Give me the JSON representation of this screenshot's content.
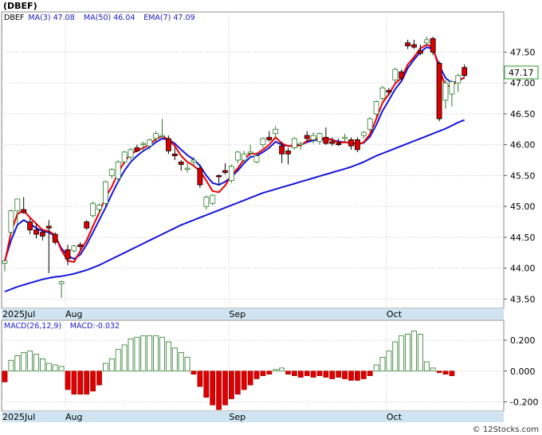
{
  "chart_data": [
    {
      "type": "candlestick",
      "title": "(DBEF)",
      "legend": [
        {
          "label": "DBEF",
          "color": "#000000"
        },
        {
          "label": "MA(3)",
          "value": "47.08",
          "color": "#1a1acc"
        },
        {
          "label": "MA(50)",
          "value": "46.04",
          "color": "#1a1acc"
        },
        {
          "label": "EMA(7)",
          "value": "47.09",
          "color": "#1a1acc"
        }
      ],
      "last_price_label": "47.17",
      "ylim": [
        43.35,
        48.15
      ],
      "yticks": [
        "43.50",
        "44.00",
        "44.50",
        "45.00",
        "45.50",
        "46.00",
        "46.50",
        "47.00",
        "47.50"
      ],
      "x_labels": [
        {
          "label": "2025Jul",
          "index": 0
        },
        {
          "label": "Aug",
          "index": 10
        },
        {
          "label": "Sep",
          "index": 36
        },
        {
          "label": "Oct",
          "index": 61
        }
      ],
      "colors": {
        "up": "#ffffff",
        "down": "#dd0000",
        "ma3": "#ee0000",
        "ma7": "#1515dd",
        "ma50": "#1515dd",
        "axis_band": "#cfe4f0"
      },
      "ohlc": [
        [
          44.08,
          44.12,
          43.95,
          44.12
        ],
        [
          44.58,
          44.95,
          44.55,
          44.93
        ],
        [
          44.93,
          45.08,
          44.7,
          45.12
        ],
        [
          44.95,
          45.15,
          44.88,
          44.9
        ],
        [
          44.75,
          44.8,
          44.55,
          44.62
        ],
        [
          44.62,
          44.72,
          44.48,
          44.55
        ],
        [
          44.58,
          44.63,
          44.45,
          44.52
        ],
        [
          44.68,
          44.78,
          43.92,
          44.65
        ],
        [
          44.55,
          44.58,
          44.38,
          44.42
        ],
        [
          43.75,
          43.8,
          43.52,
          43.78
        ],
        [
          44.3,
          44.38,
          44.05,
          44.15
        ],
        [
          44.28,
          44.38,
          44.25,
          44.36
        ],
        [
          44.38,
          44.42,
          44.3,
          44.35
        ],
        [
          44.75,
          44.78,
          44.62,
          44.65
        ],
        [
          44.85,
          45.08,
          44.82,
          45.05
        ],
        [
          44.95,
          45.05,
          44.88,
          45.02
        ],
        [
          45.05,
          45.42,
          45.0,
          45.4
        ],
        [
          45.5,
          45.62,
          45.45,
          45.6
        ],
        [
          45.45,
          45.75,
          45.4,
          45.72
        ],
        [
          45.72,
          45.9,
          45.68,
          45.88
        ],
        [
          45.8,
          45.95,
          45.75,
          45.92
        ],
        [
          45.95,
          46.0,
          45.88,
          45.9
        ],
        [
          46.0,
          46.05,
          45.88,
          46.02
        ],
        [
          45.98,
          46.1,
          45.92,
          46.08
        ],
        [
          46.1,
          46.22,
          46.05,
          46.18
        ],
        [
          46.15,
          46.42,
          46.12,
          46.15
        ],
        [
          46.1,
          46.15,
          45.85,
          45.9
        ],
        [
          45.85,
          45.95,
          45.75,
          45.82
        ],
        [
          45.72,
          45.75,
          45.58,
          45.68
        ],
        [
          45.62,
          45.7,
          45.55,
          45.62
        ],
        [
          45.72,
          45.8,
          45.65,
          45.75
        ],
        [
          45.62,
          45.68,
          45.3,
          45.35
        ],
        [
          45.0,
          45.18,
          44.95,
          45.15
        ],
        [
          45.05,
          45.2,
          45.02,
          45.18
        ],
        [
          45.5,
          45.52,
          45.35,
          45.48
        ],
        [
          45.58,
          45.7,
          45.52,
          45.55
        ],
        [
          45.42,
          45.68,
          45.38,
          45.65
        ],
        [
          45.75,
          45.9,
          45.7,
          45.88
        ],
        [
          45.75,
          45.9,
          45.72,
          45.85
        ],
        [
          45.88,
          46.0,
          45.82,
          45.88
        ],
        [
          45.72,
          45.85,
          45.7,
          45.82
        ],
        [
          46.0,
          46.12,
          45.95,
          46.1
        ],
        [
          46.12,
          46.22,
          46.05,
          46.08
        ],
        [
          46.18,
          46.3,
          46.12,
          46.25
        ],
        [
          45.98,
          46.05,
          45.7,
          45.85
        ],
        [
          45.9,
          45.95,
          45.68,
          45.85
        ],
        [
          45.95,
          46.12,
          45.92,
          46.1
        ],
        [
          46.0,
          46.05,
          45.92,
          46.02
        ],
        [
          46.15,
          46.22,
          46.05,
          46.1
        ],
        [
          46.08,
          46.2,
          46.02,
          46.15
        ],
        [
          46.05,
          46.2,
          46.0,
          46.18
        ],
        [
          46.12,
          46.28,
          46.0,
          46.02
        ],
        [
          46.05,
          46.12,
          45.98,
          46.02
        ],
        [
          46.02,
          46.1,
          45.98,
          46.0
        ],
        [
          46.1,
          46.18,
          46.05,
          46.12
        ],
        [
          46.08,
          46.12,
          45.92,
          45.98
        ],
        [
          46.08,
          46.12,
          45.88,
          45.92
        ],
        [
          46.15,
          46.22,
          46.1,
          46.2
        ],
        [
          46.25,
          46.45,
          46.2,
          46.42
        ],
        [
          46.5,
          46.72,
          46.45,
          46.7
        ],
        [
          46.75,
          46.95,
          46.72,
          46.92
        ],
        [
          46.88,
          46.92,
          46.8,
          46.85
        ],
        [
          47.05,
          47.25,
          47.0,
          47.22
        ],
        [
          47.18,
          47.22,
          47.05,
          47.08
        ],
        [
          47.65,
          47.7,
          47.55,
          47.6
        ],
        [
          47.62,
          47.7,
          47.55,
          47.58
        ],
        [
          47.52,
          47.62,
          47.45,
          47.48
        ],
        [
          47.65,
          47.75,
          47.6,
          47.7
        ],
        [
          47.72,
          47.75,
          47.45,
          47.5
        ],
        [
          47.32,
          47.35,
          46.38,
          46.42
        ],
        [
          46.72,
          47.05,
          46.58,
          47.0
        ],
        [
          46.82,
          47.05,
          46.62,
          47.02
        ],
        [
          47.0,
          47.15,
          46.85,
          47.12
        ],
        [
          47.25,
          47.3,
          47.1,
          47.12
        ]
      ],
      "ma3": [
        44.1,
        44.58,
        44.88,
        44.93,
        44.82,
        44.72,
        44.62,
        44.6,
        44.53,
        44.29,
        44.12,
        44.1,
        44.28,
        44.45,
        44.68,
        44.9,
        45.15,
        45.32,
        45.55,
        45.72,
        45.85,
        45.9,
        45.95,
        46.0,
        46.09,
        46.14,
        46.08,
        45.98,
        45.82,
        45.72,
        45.66,
        45.57,
        45.42,
        45.25,
        45.23,
        45.34,
        45.5,
        45.62,
        45.76,
        45.86,
        45.85,
        45.92,
        46.0,
        46.12,
        46.02,
        45.98,
        45.98,
        45.99,
        46.06,
        46.1,
        46.1,
        46.1,
        46.08,
        46.03,
        46.04,
        46.03,
        46.0,
        46.04,
        46.17,
        46.42,
        46.68,
        46.82,
        46.99,
        47.08,
        47.3,
        47.42,
        47.56,
        47.62,
        47.58,
        47.22,
        46.95,
        46.95,
        47.05,
        47.08
      ],
      "ma7": [
        44.12,
        44.45,
        44.7,
        44.78,
        44.72,
        44.65,
        44.6,
        44.58,
        44.52,
        44.32,
        44.2,
        44.15,
        44.22,
        44.38,
        44.58,
        44.78,
        44.98,
        45.2,
        45.4,
        45.58,
        45.72,
        45.82,
        45.9,
        45.96,
        46.04,
        46.1,
        46.08,
        46.02,
        45.92,
        45.83,
        45.76,
        45.66,
        45.5,
        45.38,
        45.35,
        45.4,
        45.48,
        45.58,
        45.7,
        45.8,
        45.82,
        45.88,
        45.95,
        46.05,
        46.0,
        45.98,
        45.99,
        46.0,
        46.04,
        46.07,
        46.08,
        46.09,
        46.08,
        46.05,
        46.04,
        46.03,
        46.01,
        46.03,
        46.13,
        46.32,
        46.55,
        46.72,
        46.9,
        47.03,
        47.24,
        47.38,
        47.5,
        47.58,
        47.55,
        47.28,
        47.08,
        47.0,
        47.03,
        47.09
      ],
      "ma50": [
        43.62,
        43.66,
        43.7,
        43.73,
        43.76,
        43.79,
        43.82,
        43.84,
        43.86,
        43.87,
        43.89,
        43.91,
        43.94,
        43.97,
        44.01,
        44.05,
        44.1,
        44.15,
        44.2,
        44.25,
        44.3,
        44.35,
        44.4,
        44.45,
        44.5,
        44.55,
        44.6,
        44.65,
        44.7,
        44.74,
        44.78,
        44.82,
        44.86,
        44.9,
        44.94,
        44.98,
        45.02,
        45.06,
        45.1,
        45.14,
        45.18,
        45.22,
        45.25,
        45.28,
        45.31,
        45.34,
        45.37,
        45.4,
        45.43,
        45.46,
        45.49,
        45.52,
        45.55,
        45.58,
        45.61,
        45.64,
        45.68,
        45.72,
        45.77,
        45.82,
        45.86,
        45.9,
        45.94,
        45.98,
        46.02,
        46.06,
        46.1,
        46.14,
        46.18,
        46.22,
        46.26,
        46.31,
        46.36,
        46.4
      ],
      "macd_panel": {
        "legend": [
          {
            "label": "MACD(26,12,9)"
          },
          {
            "label": "MACD:-0.032"
          }
        ],
        "ylim": [
          -0.26,
          0.33
        ],
        "yticks": [
          "0.200",
          "0.000",
          "-0.200"
        ],
        "hist": [
          -0.07,
          0.07,
          0.1,
          0.12,
          0.13,
          0.11,
          0.08,
          0.05,
          0.04,
          0.03,
          -0.12,
          -0.15,
          -0.15,
          -0.15,
          -0.13,
          -0.09,
          0.05,
          0.08,
          0.14,
          0.17,
          0.21,
          0.22,
          0.23,
          0.23,
          0.23,
          0.22,
          0.19,
          0.15,
          0.12,
          0.09,
          -0.02,
          -0.1,
          -0.17,
          -0.22,
          -0.25,
          -0.22,
          -0.18,
          -0.15,
          -0.12,
          -0.09,
          -0.05,
          -0.03,
          -0.02,
          0.01,
          0.02,
          -0.02,
          -0.03,
          -0.04,
          -0.03,
          -0.04,
          -0.03,
          -0.04,
          -0.05,
          -0.04,
          -0.05,
          -0.06,
          -0.06,
          -0.05,
          -0.03,
          0.04,
          0.09,
          0.13,
          0.19,
          0.23,
          0.24,
          0.26,
          0.24,
          0.06,
          0.02,
          -0.01,
          -0.02,
          -0.03
        ]
      }
    }
  ],
  "footer": {
    "watermark": "© 12Stocks.com"
  }
}
